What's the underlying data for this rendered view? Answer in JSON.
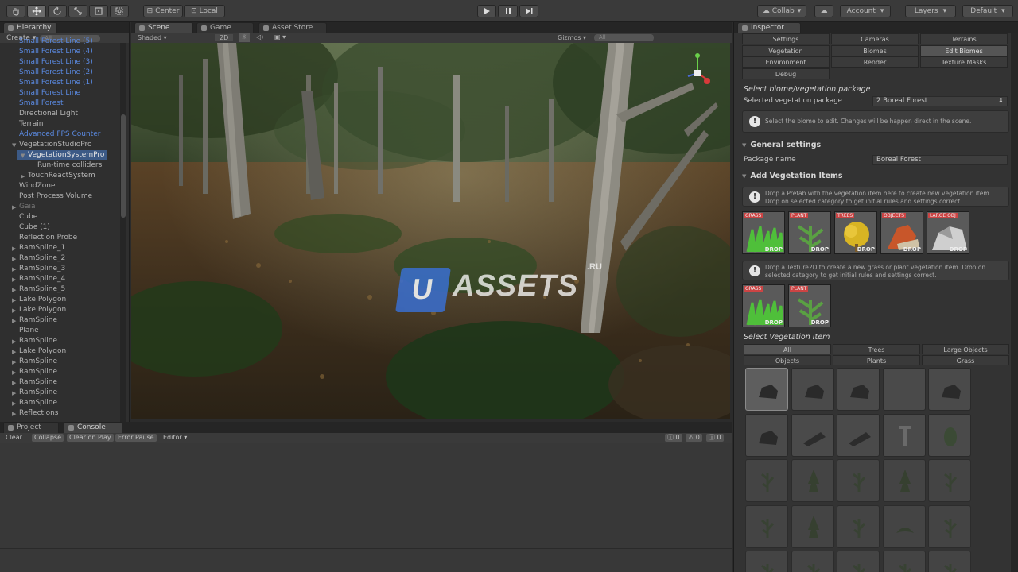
{
  "toolbar": {
    "pivot_label": "Center",
    "space_label": "Local",
    "collab_label": "Collab",
    "account_label": "Account",
    "layers_label": "Layers",
    "layout_label": "Default"
  },
  "hierarchy": {
    "tab_label": "Hierarchy",
    "create_label": "Create",
    "search_placeholder": "All",
    "items": [
      {
        "label": "Small Forest Line (5)",
        "color": "blue",
        "indent": 24
      },
      {
        "label": "Small Forest Line (4)",
        "color": "blue",
        "indent": 24
      },
      {
        "label": "Small Forest Line (3)",
        "color": "blue",
        "indent": 24
      },
      {
        "label": "Small Forest Line (2)",
        "color": "blue",
        "indent": 24
      },
      {
        "label": "Small Forest Line (1)",
        "color": "blue",
        "indent": 24
      },
      {
        "label": "Small Forest Line",
        "color": "blue",
        "indent": 24
      },
      {
        "label": "Small Forest",
        "color": "blue",
        "indent": 24
      },
      {
        "label": "Directional Light",
        "color": "normal",
        "indent": 24
      },
      {
        "label": "Terrain",
        "color": "normal",
        "indent": 24
      },
      {
        "label": "Advanced FPS Counter",
        "color": "blue",
        "indent": 24
      },
      {
        "label": "VegetationStudioPro",
        "color": "normal",
        "indent": 24,
        "arrow": "open"
      },
      {
        "label": "VegetationSystemPro",
        "color": "selected",
        "indent": 35,
        "arrow": "open"
      },
      {
        "label": "Run-time colliders",
        "color": "normal",
        "indent": 47
      },
      {
        "label": "TouchReactSystem",
        "color": "normal",
        "indent": 35,
        "arrow": "closed"
      },
      {
        "label": "WindZone",
        "color": "normal",
        "indent": 24
      },
      {
        "label": "Post Process Volume",
        "color": "normal",
        "indent": 24
      },
      {
        "label": "Gaia",
        "color": "grey",
        "indent": 24,
        "arrow": "closed"
      },
      {
        "label": "Cube",
        "color": "normal",
        "indent": 24
      },
      {
        "label": "Cube (1)",
        "color": "normal",
        "indent": 24
      },
      {
        "label": "Reflection Probe",
        "color": "normal",
        "indent": 24
      },
      {
        "label": "RamSpline_1",
        "color": "normal",
        "indent": 24,
        "arrow": "closed"
      },
      {
        "label": "RamSpline_2",
        "color": "normal",
        "indent": 24,
        "arrow": "closed"
      },
      {
        "label": "RamSpline_3",
        "color": "normal",
        "indent": 24,
        "arrow": "closed"
      },
      {
        "label": "RamSpline_4",
        "color": "normal",
        "indent": 24,
        "arrow": "closed"
      },
      {
        "label": "RamSpline_5",
        "color": "normal",
        "indent": 24,
        "arrow": "closed"
      },
      {
        "label": "Lake Polygon",
        "color": "normal",
        "indent": 24,
        "arrow": "closed"
      },
      {
        "label": "Lake Polygon",
        "color": "normal",
        "indent": 24,
        "arrow": "closed"
      },
      {
        "label": "RamSpline",
        "color": "normal",
        "indent": 24,
        "arrow": "closed"
      },
      {
        "label": "Plane",
        "color": "normal",
        "indent": 24
      },
      {
        "label": "RamSpline",
        "color": "normal",
        "indent": 24,
        "arrow": "closed"
      },
      {
        "label": "Lake Polygon",
        "color": "normal",
        "indent": 24,
        "arrow": "closed"
      },
      {
        "label": "RamSpline",
        "color": "normal",
        "indent": 24,
        "arrow": "closed"
      },
      {
        "label": "RamSpline",
        "color": "normal",
        "indent": 24,
        "arrow": "closed"
      },
      {
        "label": "RamSpline",
        "color": "normal",
        "indent": 24,
        "arrow": "closed"
      },
      {
        "label": "RamSpline",
        "color": "normal",
        "indent": 24,
        "arrow": "closed"
      },
      {
        "label": "RamSpline",
        "color": "normal",
        "indent": 24,
        "arrow": "closed"
      },
      {
        "label": "Reflections",
        "color": "normal",
        "indent": 24,
        "arrow": "closed"
      }
    ]
  },
  "scene": {
    "tabs": [
      "Scene",
      "Game",
      "Asset Store"
    ],
    "shading_mode": "Shaded",
    "mode_2d": "2D",
    "gizmos_label": "Gizmos",
    "search_placeholder": "All",
    "watermark_text": "ASSETS",
    "watermark_letter": "U",
    "watermark_suffix": ".RU"
  },
  "console": {
    "tabs": [
      "Project",
      "Console"
    ],
    "buttons": [
      "Clear",
      "Collapse",
      "Clear on Play",
      "Error Pause",
      "Editor"
    ],
    "count_info": "0",
    "count_warn": "0",
    "count_error": "0"
  },
  "inspector": {
    "tab_label": "Inspector",
    "top_tabs": [
      [
        "Settings",
        "Cameras",
        "Terrains"
      ],
      [
        "Vegetation",
        "Biomes",
        "Edit Biomes"
      ],
      [
        "Environment",
        "Render",
        "Texture Masks"
      ],
      [
        "Debug"
      ]
    ],
    "selected_top_tab": "Edit Biomes",
    "select_biome_title": "Select biome/vegetation package",
    "selected_package_label": "Selected vegetation package",
    "selected_package_value": "2 Boreal Forest",
    "biome_help": "Select the biome to edit. Changes will be happen direct in the scene.",
    "general_settings_title": "General settings",
    "package_name_label": "Package name",
    "package_name_value": "Boreal Forest",
    "add_items_title": "Add Vegetation Items",
    "prefab_help": "Drop a Prefab with the vegetation item here to create new vegetation item. Drop on selected category to get initial rules and settings correct.",
    "prefab_drop_tags": [
      "GRASS",
      "PLANT",
      "TREES",
      "OBJECTS",
      "LARGE OBJ"
    ],
    "texture_help": "Drop a Texture2D to create a new grass or plant vegetation item. Drop on selected category to get initial rules and settings correct.",
    "texture_drop_tags": [
      "GRASS",
      "PLANT"
    ],
    "drop_label": "DROP",
    "select_item_title": "Select Vegetation Item",
    "categories": [
      [
        "All",
        "Trees",
        "Large Objects"
      ],
      [
        "Objects",
        "Plants",
        "Grass"
      ]
    ],
    "selected_category": "All",
    "colors": {
      "accent_blue": "#5a89e0",
      "selected_row": "#3c5a86",
      "panel_bg": "#333333"
    }
  }
}
